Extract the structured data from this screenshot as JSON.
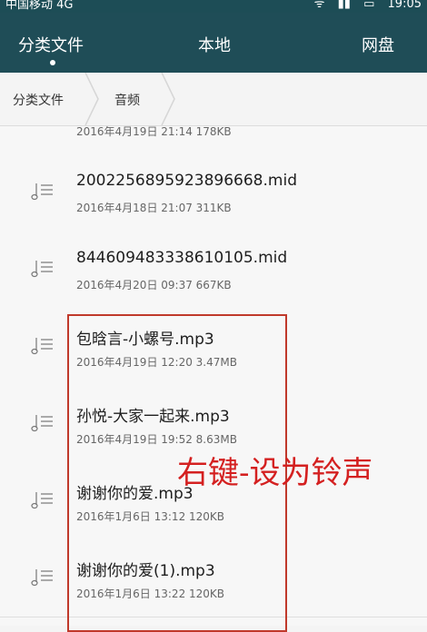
{
  "status_bar": {
    "carrier": "中国移动 4G",
    "time": "19:05",
    "icons": [
      "gallery-icon",
      "wifi-icon",
      "signal-icon",
      "sim-icon",
      "battery-icon"
    ]
  },
  "tabs": [
    {
      "label": "分类文件",
      "active": true
    },
    {
      "label": "本地",
      "active": false
    },
    {
      "label": "网盘",
      "active": false
    }
  ],
  "breadcrumb": [
    "分类文件",
    "音频"
  ],
  "files": [
    {
      "name": "",
      "meta": "2016年4月19日 21:14 178KB"
    },
    {
      "name": "2002256895923896668.mid",
      "meta": "2016年4月18日 21:07 311KB"
    },
    {
      "name": "844609483338610105.mid",
      "meta": "2016年4月20日 09:37 667KB"
    },
    {
      "name": "包晗言-小螺号.mp3",
      "meta": "2016年4月19日 12:20 3.47MB"
    },
    {
      "name": "孙悦-大家一起来.mp3",
      "meta": "2016年4月19日 19:52 8.63MB"
    },
    {
      "name": "谢谢你的爱.mp3",
      "meta": "2016年1月6日 13:12 120KB"
    },
    {
      "name": "谢谢你的爱(1).mp3",
      "meta": "2016年1月6日 13:22 120KB"
    }
  ],
  "annotation": "右键-设为铃声",
  "colors": {
    "header": "#1f4d57",
    "annotation": "#d42020",
    "highlight_border": "#c0392b"
  }
}
